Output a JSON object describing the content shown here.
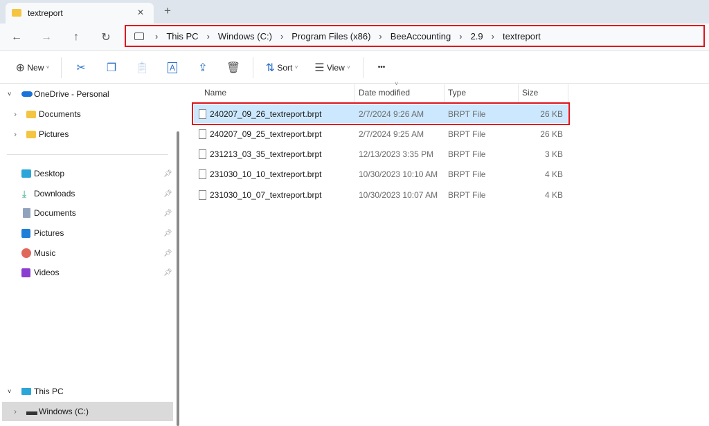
{
  "window": {
    "tab_title": "textreport",
    "close_tab": "✕",
    "new_tab": "+"
  },
  "nav": {
    "back": "←",
    "forward": "→",
    "up": "↑",
    "refresh": "↻",
    "breadcrumb": [
      "This PC",
      "Windows (C:)",
      "Program Files (x86)",
      "BeeAccounting",
      "2.9",
      "textreport"
    ]
  },
  "toolbar": {
    "new_label": "New",
    "sort_label": "Sort",
    "view_label": "View",
    "more": "•••"
  },
  "sidebar": {
    "onedrive": "OneDrive - Personal",
    "onedrive_children": [
      "Documents",
      "Pictures"
    ],
    "quick_access": [
      "Desktop",
      "Downloads",
      "Documents",
      "Pictures",
      "Music",
      "Videos"
    ],
    "this_pc": "This PC",
    "drive": "Windows (C:)"
  },
  "columns": {
    "name": "Name",
    "date": "Date modified",
    "type": "Type",
    "size": "Size"
  },
  "files": [
    {
      "name": "240207_09_26_textreport.brpt",
      "date": "2/7/2024 9:26 AM",
      "type": "BRPT File",
      "size": "26 KB",
      "selected": true
    },
    {
      "name": "240207_09_25_textreport.brpt",
      "date": "2/7/2024 9:25 AM",
      "type": "BRPT File",
      "size": "26 KB"
    },
    {
      "name": "231213_03_35_textreport.brpt",
      "date": "12/13/2023 3:35 PM",
      "type": "BRPT File",
      "size": "3 KB"
    },
    {
      "name": "231030_10_10_textreport.brpt",
      "date": "10/30/2023 10:10 AM",
      "type": "BRPT File",
      "size": "4 KB"
    },
    {
      "name": "231030_10_07_textreport.brpt",
      "date": "10/30/2023 10:07 AM",
      "type": "BRPT File",
      "size": "4 KB"
    }
  ],
  "colors": {
    "selection": "#cce8ff",
    "highlight_border": "#e0121b",
    "accent": "#2a6fc9"
  }
}
